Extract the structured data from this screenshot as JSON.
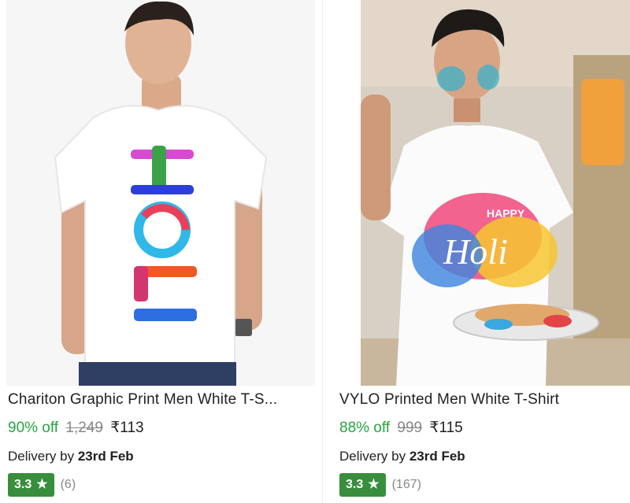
{
  "products": [
    {
      "title": "Chariton Graphic Print Men White T-S...",
      "discount": "90% off",
      "mrp": "1,249",
      "price": "₹113",
      "delivery_prefix": "Delivery by",
      "delivery_date": "23rd Feb",
      "rating": "3.3",
      "reviews": "(6)",
      "image_text": "HOLI"
    },
    {
      "title": "VYLO Printed Men White T-Shirt",
      "discount": "88% off",
      "mrp": "999",
      "price": "₹115",
      "delivery_prefix": "Delivery by",
      "delivery_date": "23rd Feb",
      "rating": "3.3",
      "reviews": "(167)",
      "image_text_small": "HAPPY",
      "image_text_big": "Holi"
    }
  ],
  "colors": {
    "discount": "#26a541",
    "badge": "#388e3c",
    "muted": "#878787",
    "text": "#212121"
  }
}
